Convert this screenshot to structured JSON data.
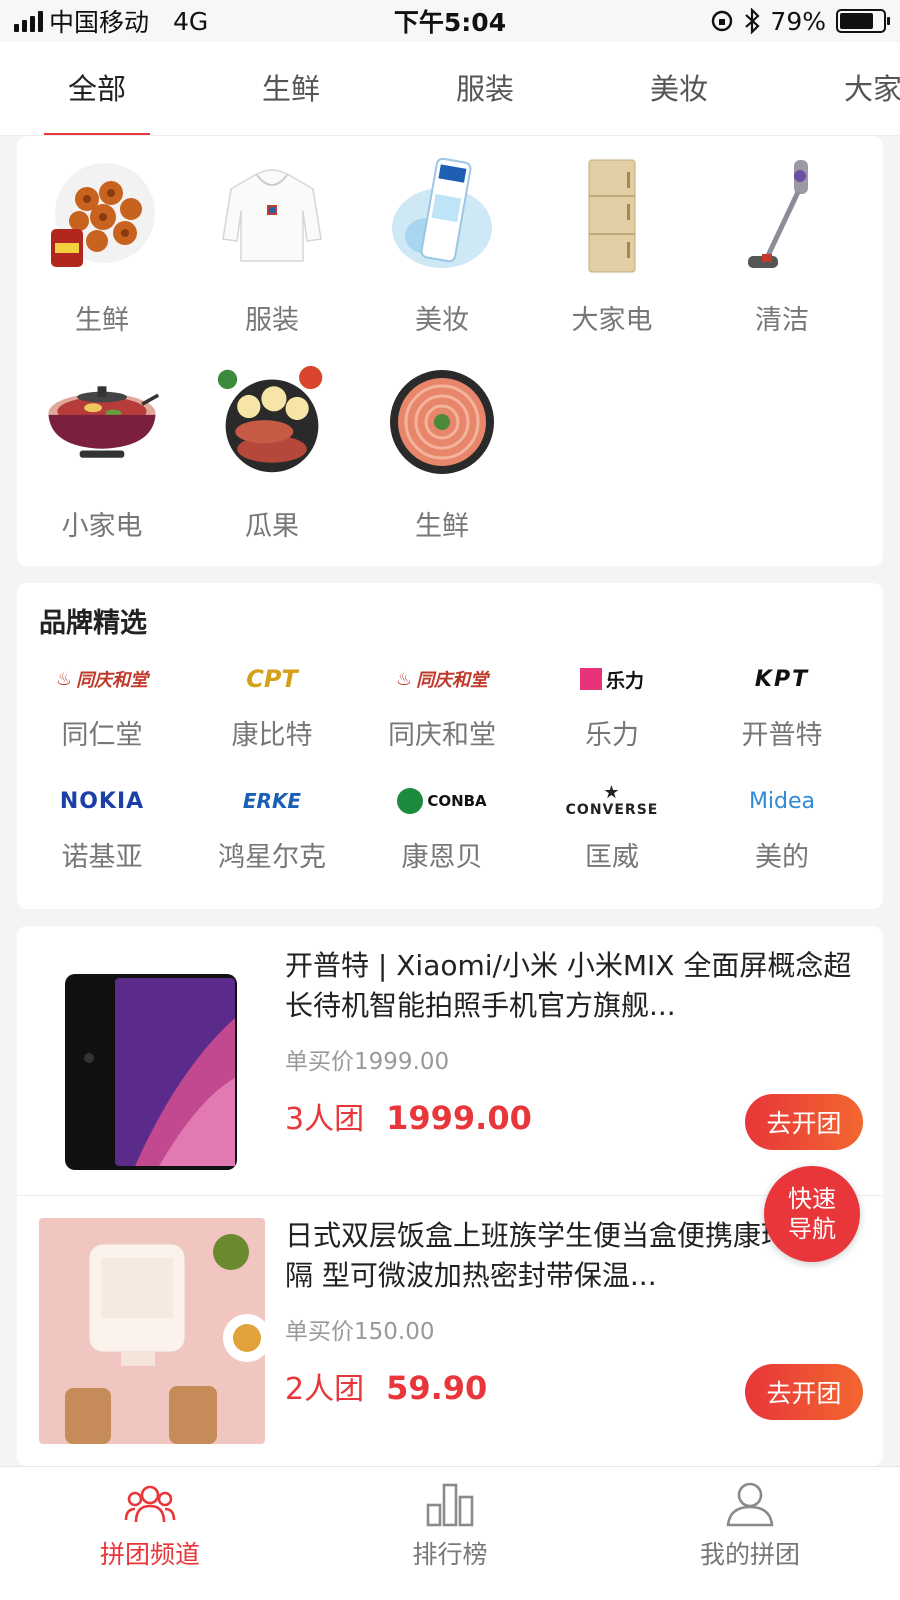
{
  "status_bar": {
    "carrier": "中国移动",
    "network": "4G",
    "time": "下午5:04",
    "battery": "79%",
    "battery_level": 0.79
  },
  "tabs": [
    {
      "label": "全部",
      "active": true
    },
    {
      "label": "生鲜",
      "active": false
    },
    {
      "label": "服装",
      "active": false
    },
    {
      "label": "美妆",
      "active": false
    },
    {
      "label": "大家",
      "active": false
    }
  ],
  "categories": [
    {
      "label": "生鲜",
      "icon": "seafood-crab-image"
    },
    {
      "label": "服装",
      "icon": "hoodie-image"
    },
    {
      "label": "美妆",
      "icon": "toothpaste-image"
    },
    {
      "label": "大家电",
      "icon": "refrigerator-image"
    },
    {
      "label": "清洁",
      "icon": "vacuum-cleaner-image"
    },
    {
      "label": "小家电",
      "icon": "electric-hot-pot-image"
    },
    {
      "label": "瓜果",
      "icon": "sweet-potato-image"
    },
    {
      "label": "生鲜",
      "icon": "shrimp-plate-image"
    }
  ],
  "brands": {
    "title": "品牌精选",
    "items": [
      {
        "name": "同仁堂",
        "logo_text": "同庆和堂",
        "logo_color": "#c0392b"
      },
      {
        "name": "康比特",
        "logo_text": "CPT",
        "logo_color": "#d4a017"
      },
      {
        "name": "同庆和堂",
        "logo_text": "同庆和堂",
        "logo_color": "#c0392b"
      },
      {
        "name": "乐力",
        "logo_text": "乐力",
        "logo_color": "#111111"
      },
      {
        "name": "开普特",
        "logo_text": "KPT",
        "logo_color": "#111111"
      },
      {
        "name": "诺基亚",
        "logo_text": "NOKIA",
        "logo_color": "#1a3fa8"
      },
      {
        "name": "鸿星尔克",
        "logo_text": "ERKE",
        "logo_color": "#1a5fb4"
      },
      {
        "name": "康恩贝",
        "logo_text": "CONBA",
        "logo_color": "#1e8a3e"
      },
      {
        "name": "匡威",
        "logo_text": "CONVERSE",
        "logo_color": "#222222"
      },
      {
        "name": "美的",
        "logo_text": "Midea",
        "logo_color": "#2f8bd8"
      }
    ]
  },
  "products": [
    {
      "title": "开普特 | Xiaomi/小米 小米MIX 全面屏概念超长待机智能拍照手机官方旗舰...",
      "single_price": "单买价1999.00",
      "group_size": "3人团",
      "group_price": "1999.00",
      "button": "去开团"
    },
    {
      "title": "日式双层饭盒上班族学生便当盒便携康环保分隔 型可微波加热密封带保温...",
      "single_price": "单买价150.00",
      "group_size": "2人团",
      "group_price": "59.90",
      "button": "去开团"
    }
  ],
  "quick_nav": {
    "line1": "快速",
    "line2": "导航"
  },
  "bottom_nav": [
    {
      "label": "拼团频道",
      "icon": "group-people-icon",
      "active": true
    },
    {
      "label": "排行榜",
      "icon": "bar-chart-icon",
      "active": false
    },
    {
      "label": "我的拼团",
      "icon": "person-icon",
      "active": false
    }
  ],
  "colors": {
    "accent": "#e8363a",
    "accent_gradient_end": "#f2672f"
  }
}
